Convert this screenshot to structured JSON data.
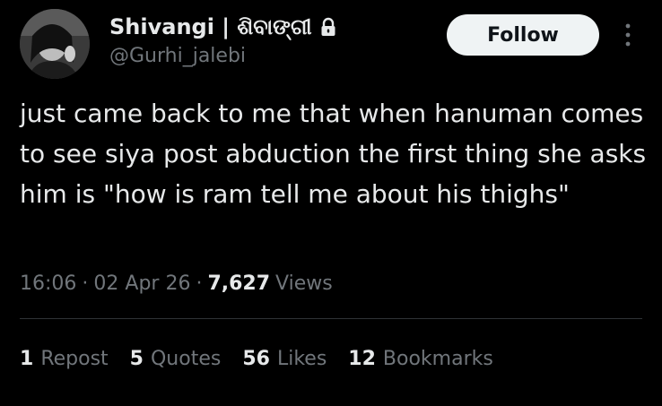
{
  "author": {
    "display_name": "Shivangi | ଶିବାଙ୍ଗୀ",
    "handle": "@Gurhi_jalebi",
    "lock_icon": "lock-icon",
    "avatar_icon": "avatar-photo"
  },
  "actions": {
    "follow_label": "Follow",
    "more_icon": "more-vertical-icon"
  },
  "tweet": {
    "text": "just came back to me that when hanuman comes to see siya post abduction the first thing she asks him is \"how is ram tell me about his thighs\""
  },
  "meta": {
    "time": "16:06",
    "date": "02 Apr 26",
    "views_count": "7,627",
    "views_label": "Views",
    "separator": "·"
  },
  "stats": [
    {
      "count": "1",
      "label": "Repost"
    },
    {
      "count": "5",
      "label": "Quotes"
    },
    {
      "count": "56",
      "label": "Likes"
    },
    {
      "count": "12",
      "label": "Bookmarks"
    }
  ],
  "colors": {
    "background": "#000000",
    "primary_text": "#e7e9ea",
    "secondary_text": "#71767b",
    "divider": "#2f3336",
    "follow_bg": "#eff3f4",
    "follow_text": "#0f1419"
  }
}
